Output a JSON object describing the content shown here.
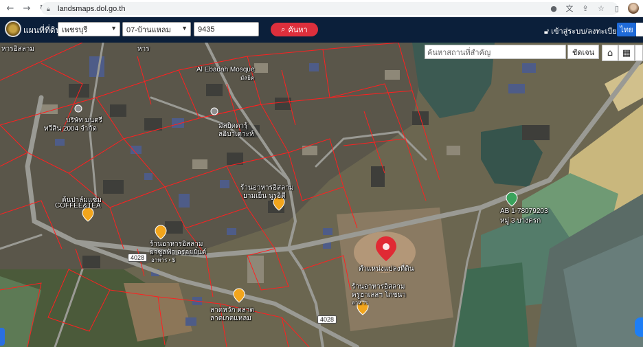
{
  "browser": {
    "url": "landsmaps.dol.go.th",
    "icons": [
      "back-arrow-icon",
      "forward-arrow-icon",
      "reload-icon",
      "lock-icon",
      "location-icon",
      "translate-icon",
      "share-icon",
      "bookmark-star-icon",
      "sidepanel-icon",
      "profile-avatar"
    ]
  },
  "header": {
    "title": "แผนที่ที่ดิน",
    "province": "เพชรบุรี",
    "district": "07-บ้านแหลม",
    "parcel_number": "9435",
    "search_label": "ค้นหา",
    "login_label": "เข้าสู่ระบบ/ลงทะเบียน",
    "language": "ไทย",
    "colors": {
      "bar": "#0b1f3a",
      "search": "#dd2f3c",
      "lang": "#1e6ad8"
    }
  },
  "map": {
    "place_search_placeholder": "ค้นหาสถานที่สำคัญ",
    "locate_label": "ชัดเจน",
    "tools": [
      "home-icon",
      "grid-icon"
    ],
    "labels": {
      "top_left": "หารอิสลาม",
      "top_mid": "หาร",
      "mosque": "Al Ebadah Mosque",
      "mosque_sub": "มัสยิด",
      "company": "บริษัท มนตรี",
      "company_sub": "ทวีสิน 2004 จำกัด",
      "masjid": "มัสยิดดารุ้",
      "masjid_sub": "ลอิบาเดาะห์",
      "rest1": "ร้านอาหารอิสลาม",
      "rest1_sub": "ยามเย็น นูรอิดี",
      "cafe": "ต้นปาล์มแซ่ม",
      "cafe_sub": "COFFEE&TEA",
      "rest2": "ร้านอาหารอิสลาม",
      "rest2_sub": "ยาซูลฟ้า อร่อยยั่นต์",
      "rest2_extra": "อาหาร • $",
      "parcel": "ตำแหน่งแปลงที่ดิน",
      "rest3": "ร้านอาหารอิสลาม",
      "rest3_sub": "ครูฮาเลสฯ โภชนา",
      "rest3_extra": "อาหาร",
      "market": "ลาดหวัก ตลาด",
      "market_sub": "ลาดเกตแหลม",
      "poi": "AB 1-78079203",
      "poi_sub": "หมู่ 3 บางครก",
      "road_a": "4028",
      "road_b": "4028"
    },
    "pin_color": "#e02a34",
    "parcel_line_color": "#ff2020"
  }
}
